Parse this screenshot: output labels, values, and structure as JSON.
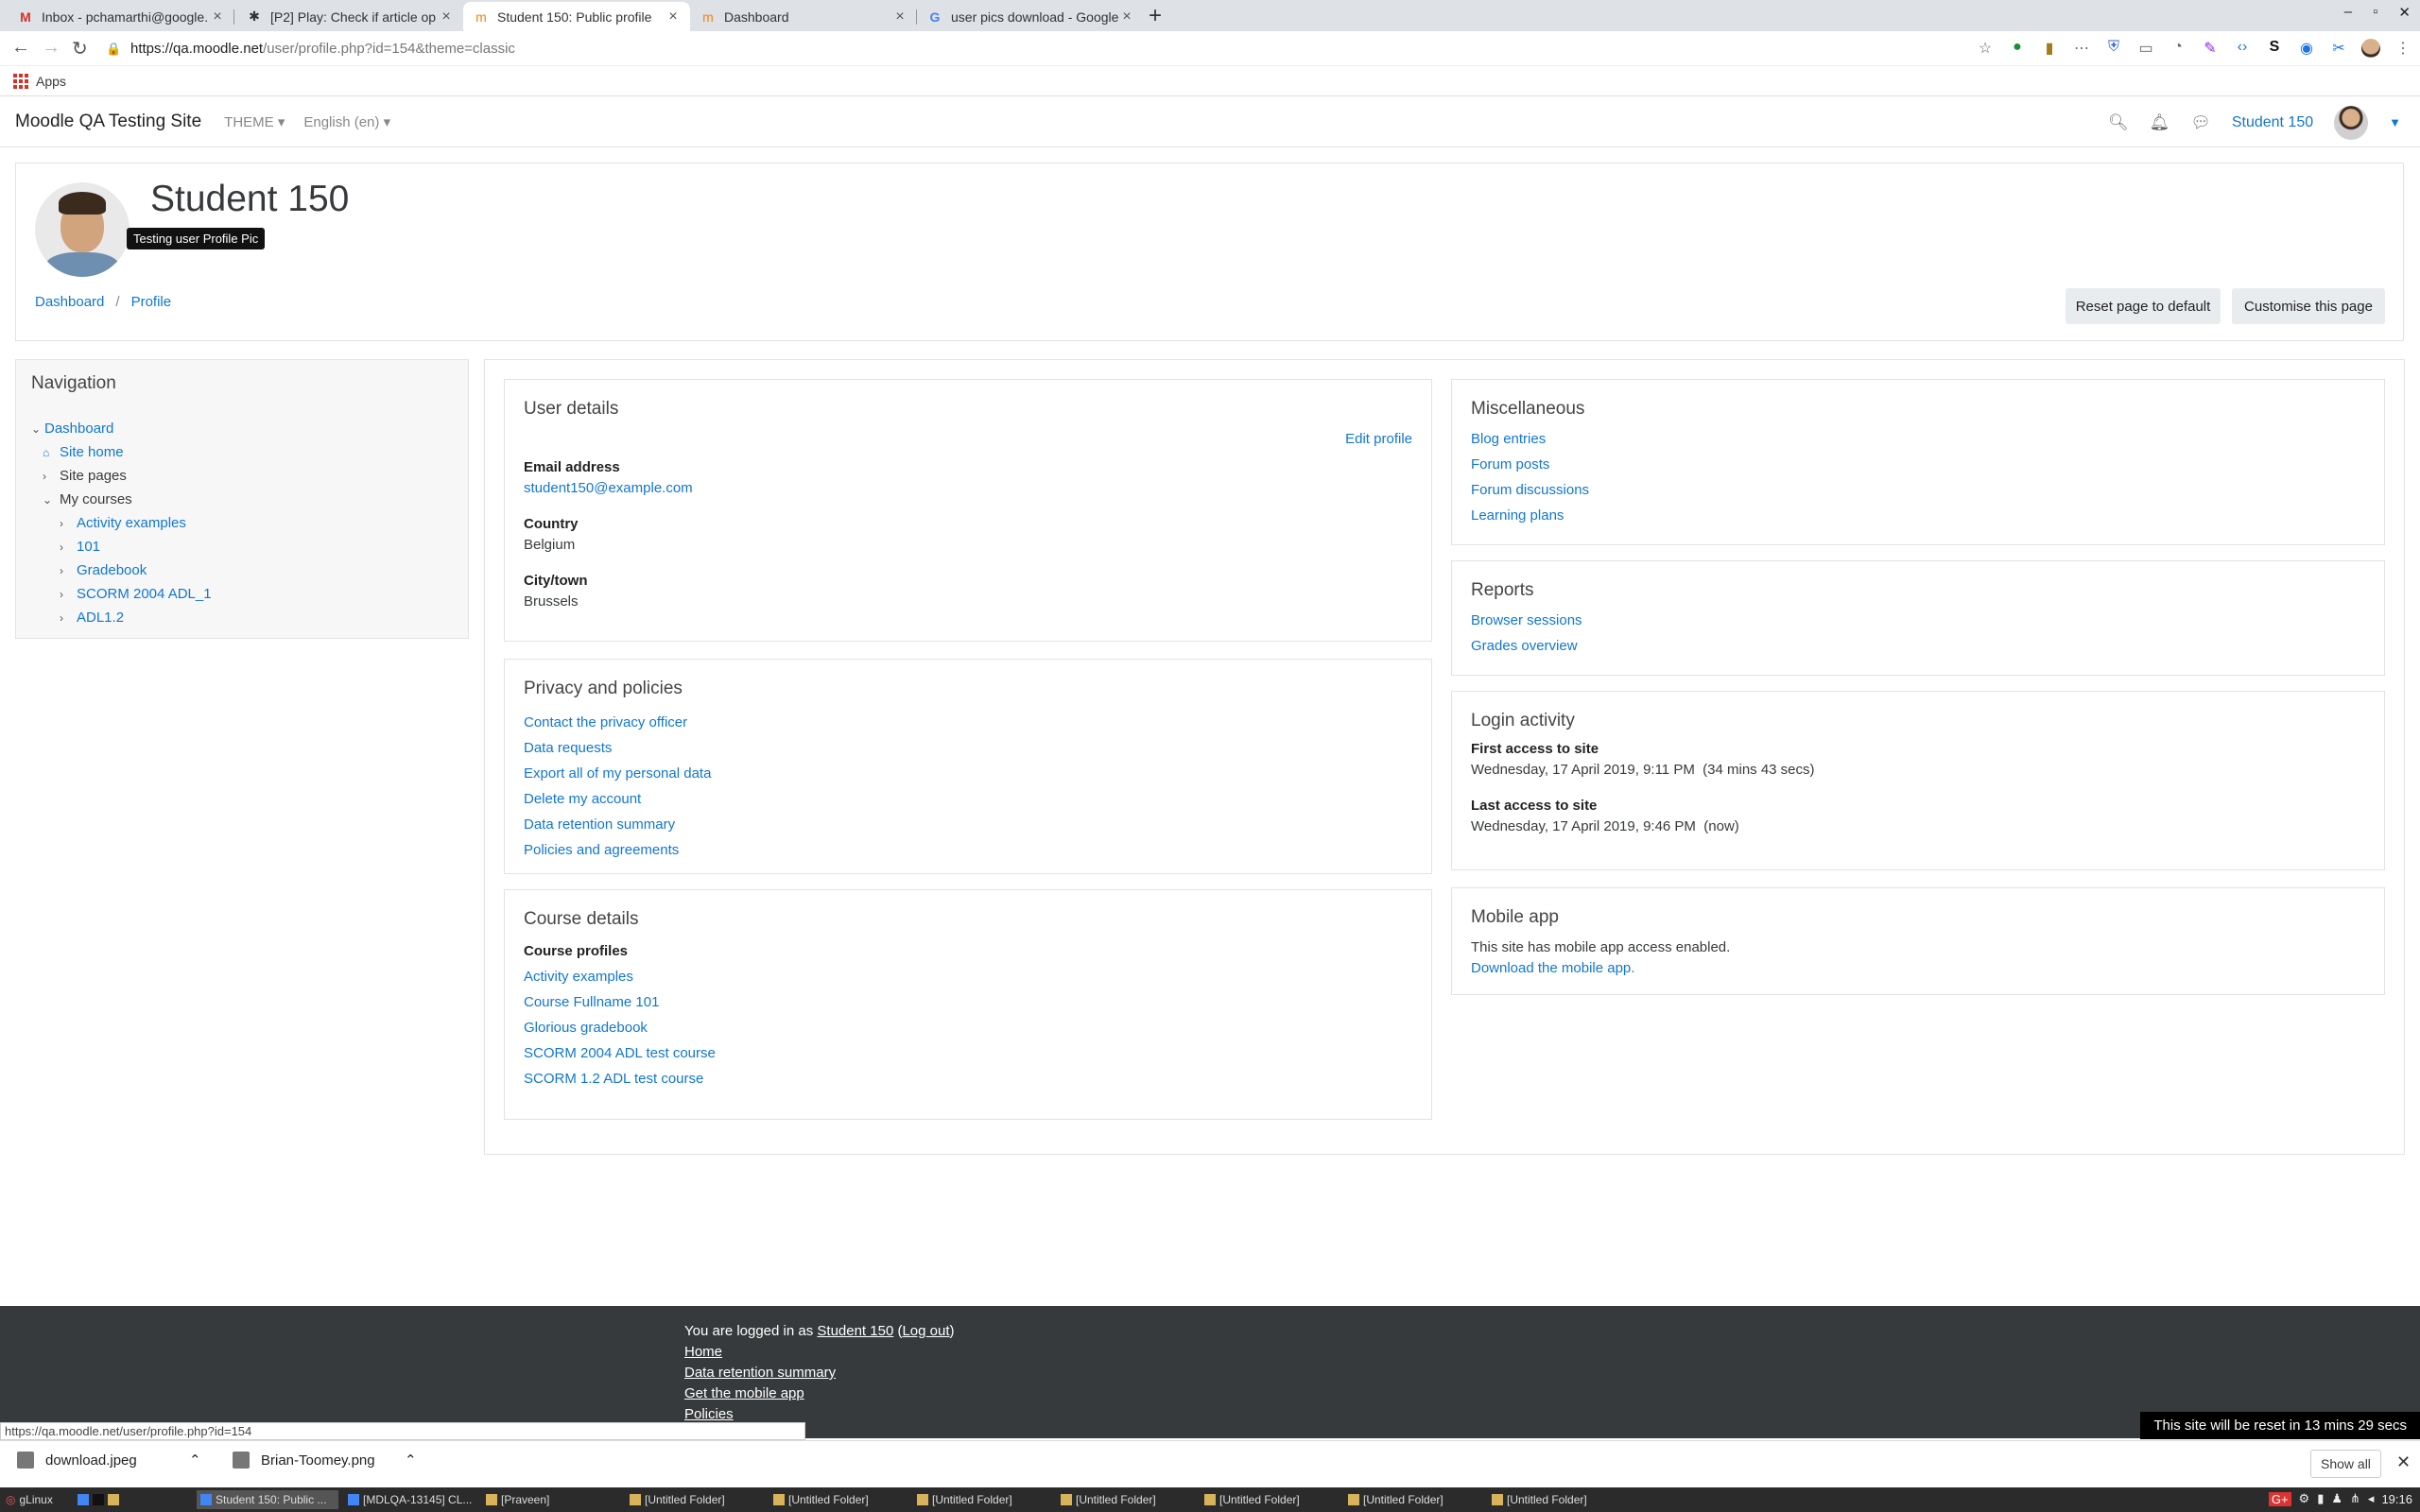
{
  "browser": {
    "tabs": [
      {
        "label": "Inbox - pchamarthi@google.",
        "icon": "gmail-icon"
      },
      {
        "label": "[P2] Play: Check if article op",
        "icon": "bug-icon"
      },
      {
        "label": "Student 150: Public profile",
        "icon": "moodle-icon"
      },
      {
        "label": "Dashboard",
        "icon": "moodle-icon"
      },
      {
        "label": "user pics download - Google",
        "icon": "google-icon"
      }
    ],
    "url_host": "https://qa.moodle.net",
    "url_path": "/user/profile.php?id=154&theme=classic",
    "bookmarks_apps": "Apps"
  },
  "navbar": {
    "site_name": "Moodle QA Testing Site",
    "theme_menu": "THEME",
    "language_menu": "English (en)",
    "user_name": "Student 150"
  },
  "header": {
    "title": "Student 150",
    "tooltip": "Testing user Profile Pic",
    "breadcrumb": [
      "Dashboard",
      "Profile"
    ],
    "reset_button": "Reset page to default",
    "customise_button": "Customise this page"
  },
  "navigation": {
    "title": "Navigation",
    "items": [
      {
        "label": "Dashboard",
        "link": true
      },
      {
        "label": "Site home",
        "link": true
      },
      {
        "label": "Site pages",
        "link": false
      },
      {
        "label": "My courses",
        "link": false
      },
      {
        "label": "Activity examples",
        "link": true
      },
      {
        "label": "101",
        "link": true
      },
      {
        "label": "Gradebook",
        "link": true
      },
      {
        "label": "SCORM 2004 ADL_1",
        "link": true
      },
      {
        "label": "ADL1.2",
        "link": true
      }
    ]
  },
  "user_details": {
    "title": "User details",
    "edit_profile": "Edit profile",
    "email_label": "Email address",
    "email": "student150@example.com",
    "country_label": "Country",
    "country": "Belgium",
    "city_label": "City/town",
    "city": "Brussels"
  },
  "privacy": {
    "title": "Privacy and policies",
    "links": [
      "Contact the privacy officer",
      "Data requests",
      "Export all of my personal data",
      "Delete my account",
      "Data retention summary",
      "Policies and agreements"
    ]
  },
  "course_details": {
    "title": "Course details",
    "profiles_label": "Course profiles",
    "links": [
      "Activity examples",
      "Course Fullname 101",
      "Glorious gradebook",
      "SCORM 2004 ADL test course",
      "SCORM 1.2 ADL test course"
    ]
  },
  "misc": {
    "title": "Miscellaneous",
    "links": [
      "Blog entries",
      "Forum posts",
      "Forum discussions",
      "Learning plans"
    ]
  },
  "reports": {
    "title": "Reports",
    "links": [
      "Browser sessions",
      "Grades overview"
    ]
  },
  "login_activity": {
    "title": "Login activity",
    "first_label": "First access to site",
    "first_value": "Wednesday, 17 April 2019, 9:11 PM  (34 mins 43 secs)",
    "last_label": "Last access to site",
    "last_value": "Wednesday, 17 April 2019, 9:46 PM  (now)"
  },
  "mobile_app": {
    "title": "Mobile app",
    "text": "This site has mobile app access enabled.",
    "link": "Download the mobile app."
  },
  "footer": {
    "logged_in_prefix": "You are logged in as ",
    "user": "Student 150",
    "logout": "Log out",
    "links": [
      "Home",
      "Data retention summary",
      "Get the mobile app",
      "Policies"
    ],
    "reset_note": "This site will be reset in 13 mins 29 secs"
  },
  "status_url": "https://qa.moodle.net/user/profile.php?id=154",
  "downloads": {
    "items": [
      "download.jpeg",
      "Brian-Toomey.png"
    ],
    "show_all": "Show all"
  },
  "taskbar": {
    "start": "gLinux",
    "tasks": [
      "Student 150: Public ...",
      "[MDLQA-13145] CL...",
      "[Praveen]",
      "[Untitled Folder]",
      "[Untitled Folder]",
      "[Untitled Folder]",
      "[Untitled Folder]",
      "[Untitled Folder]",
      "[Untitled Folder]",
      "[Untitled Folder]"
    ],
    "clock": "19:16"
  }
}
